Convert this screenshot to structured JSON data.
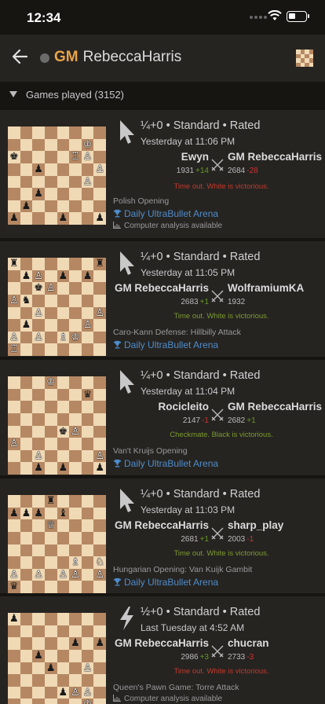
{
  "status_bar": {
    "time": "12:34"
  },
  "header": {
    "title_tag": "GM",
    "title_name": "RebeccaHarris"
  },
  "section": {
    "label": "Games played (3152)"
  },
  "colors": {
    "result_white": "#c0392b",
    "result_black": "#7a9a2f",
    "tournament": "#4f8ccb",
    "gm_tag": "#e8a449",
    "rating_up": "#629924",
    "rating_down": "#cc3333"
  },
  "games": [
    {
      "speed_icon": "cursor-icon",
      "meta": "¼+0 • Standard • Rated",
      "date": "Yesterday at 11:06 PM",
      "white": {
        "name": "Ewyn",
        "rating": "1931",
        "diff": "+14"
      },
      "black": {
        "name": "GM RebeccaHarris",
        "rating": "2684",
        "diff": "-28"
      },
      "result": "Time out. White is victorious.",
      "result_side": "white",
      "opening": "Polish Opening",
      "tournament": "Daily UltraBullet Arena",
      "analysis": "Computer analysis available",
      "board": [
        "........",
        "......♔.",
        "♚....♖♙.",
        "..♟....♙",
        "......♙.",
        "..♟.....",
        ".♟......",
        "♟...♟..♟"
      ]
    },
    {
      "speed_icon": "cursor-icon",
      "meta": "¼+0 • Standard • Rated",
      "date": "Yesterday at 11:05 PM",
      "white": {
        "name": "GM RebeccaHarris",
        "rating": "2683",
        "diff": "+1"
      },
      "black": {
        "name": "WolframiumKA",
        "rating": "1932",
        "diff": ""
      },
      "result": "Time out. White is victorious.",
      "result_side": "black",
      "opening": "Caro-Kann Defense: Hillbilly Attack",
      "tournament": "Daily UltraBullet Arena",
      "analysis": "",
      "board": [
        "♜......♜",
        ".♟♙.♟.♟.",
        "..♚♙....",
        "♙♞......",
        "..♙....♙",
        ".♟....♙.",
        "♙.♙.♗♔..",
        "♖......."
      ]
    },
    {
      "speed_icon": "cursor-icon",
      "meta": "¼+0 • Standard • Rated",
      "date": "Yesterday at 11:04 PM",
      "white": {
        "name": "Rocicleito",
        "rating": "2147",
        "diff": "-1"
      },
      "black": {
        "name": "GM RebeccaHarris",
        "rating": "2682",
        "diff": "+1"
      },
      "result": "Checkmate. Black is victorious.",
      "result_side": "black",
      "opening": "Van't Kruijs Opening",
      "tournament": "Daily UltraBullet Arena",
      "analysis": "",
      "board": [
        "...♔....",
        "......♛.",
        "........",
        "........",
        "....♚♙..",
        "♙.......",
        "..♙....♙",
        "..♟.♟..♟"
      ]
    },
    {
      "speed_icon": "cursor-icon",
      "meta": "¼+0 • Standard • Rated",
      "date": "Yesterday at 11:03 PM",
      "white": {
        "name": "GM RebeccaHarris",
        "rating": "2681",
        "diff": "+1"
      },
      "black": {
        "name": "sharp_play",
        "rating": "2003",
        "diff": "-1"
      },
      "result": "Time out. White is victorious.",
      "result_side": "black",
      "opening": "Hungarian Opening: Van Kuijk Gambit",
      "tournament": "Daily UltraBullet Arena",
      "analysis": "",
      "board": [
        "...♜....",
        "♟♟♟.♝...",
        "...♕....",
        "........",
        "........",
        ".....♗.♘",
        "♙.♙.♙♙.♙",
        "♛......."
      ]
    },
    {
      "speed_icon": "bolt-icon",
      "meta": "½+0 • Standard • Rated",
      "date": "Last Tuesday at 4:52 AM",
      "white": {
        "name": "GM RebeccaHarris",
        "rating": "2986",
        "diff": "+3"
      },
      "black": {
        "name": "chucran",
        "rating": "2733",
        "diff": "-3"
      },
      "result": "Time out. White is victorious.",
      "result_side": "white",
      "opening": "Queen's Pawn Game: Torre Attack",
      "tournament": "",
      "analysis": "Computer analysis available",
      "board": [
        "♟.......",
        "........",
        ".....♟.♟",
        "..♟.....",
        "...♟..♙.",
        "........",
        "....♟♙♙.",
        "......♔."
      ]
    }
  ]
}
